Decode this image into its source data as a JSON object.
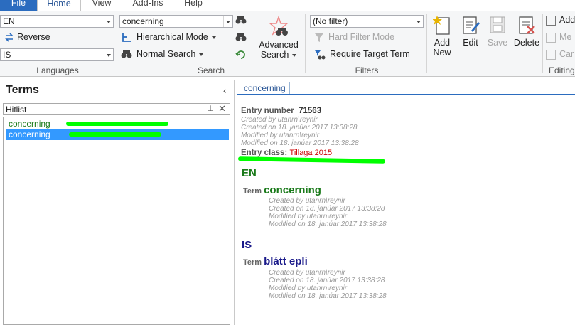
{
  "tabs": [
    "File",
    "Home",
    "View",
    "Add-Ins",
    "Help"
  ],
  "languages": {
    "source_lang": "EN",
    "reverse_label": "Reverse",
    "target_lang": "IS",
    "group_label": "Languages"
  },
  "search": {
    "query": "concerning",
    "hierarchical_mode_label": "Hierarchical Mode",
    "normal_search_label": "Normal Search",
    "advanced_search_label_1": "Advanced",
    "advanced_search_label_2": "Search",
    "group_label": "Search"
  },
  "filters": {
    "filter_value": "(No filter)",
    "hard_filter_label": "Hard Filter Mode",
    "require_target_label": "Require Target Term",
    "group_label": "Filters"
  },
  "editing": {
    "add_new_label_1": "Add",
    "add_new_label_2": "New",
    "edit_label": "Edit",
    "save_label": "Save",
    "delete_label": "Delete",
    "add_label": "Add",
    "merge_label": "Me",
    "cancel_label": "Car",
    "group_label": "Editing"
  },
  "terms_panel": {
    "title": "Terms",
    "collapse_glyph": "‹",
    "hitlist_label": "Hitlist",
    "pin_glyph": "⊥",
    "close_glyph": "✕",
    "items": [
      "concerning",
      "concerning"
    ]
  },
  "entry": {
    "tab_label": "concerning",
    "entry_number_label": "Entry number",
    "entry_number": "71563",
    "created_by": "Created by  utanrn\\reynir",
    "created_on": "Created on  18. janúar 2017 13:38:28",
    "modified_by": "Modified by  utanrn\\reynir",
    "modified_on": "Modified on  18. janúar 2017 13:38:28",
    "entry_class_label": "Entry class:",
    "entry_class_value": "Tillaga 2015",
    "en_label": "EN",
    "en_term_label": "Term",
    "en_term": "concerning",
    "en_created_by": "Created by  utanrn\\reynir",
    "en_created_on": "Created on  18. janúar 2017 13:38:28",
    "en_modified_by": "Modified by  utanrn\\reynir",
    "en_modified_on": "Modified on  18. janúar 2017 13:38:28",
    "is_label": "IS",
    "is_term_label": "Term",
    "is_term": "blátt epli",
    "is_created_by": "Created by  utanrn\\reynir",
    "is_created_on": "Created on  18. janúar 2017 13:38:28",
    "is_modified_by": "Modified by  utanrn\\reynir",
    "is_modified_on": "Modified on  18. janúar 2017 13:38:28"
  },
  "colors": {
    "accent": "#2b6cbf",
    "en_color": "#1a7a1a",
    "is_color": "#1a1a8a",
    "entry_class_color": "#cc0000",
    "highlight": "#00ff00",
    "selection": "#3399ff"
  }
}
